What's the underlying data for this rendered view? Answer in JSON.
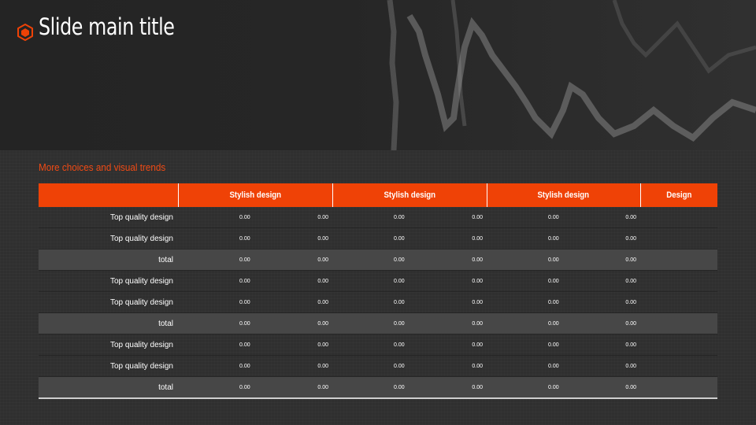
{
  "slide": {
    "title": "Slide main title",
    "subtitle": "More choices and visual trends",
    "accent_color": "#ef4206",
    "icon": "cube-icon"
  },
  "table": {
    "headers": [
      "",
      "Stylish design",
      "Stylish design",
      "Stylish design",
      "Design"
    ],
    "rows": [
      {
        "label": "Top quality design",
        "type": "normal",
        "values": [
          "0.00",
          "0.00",
          "0.00",
          "0.00",
          "0.00",
          "0.00"
        ]
      },
      {
        "label": "Top quality design",
        "type": "normal",
        "values": [
          "0.00",
          "0.00",
          "0.00",
          "0.00",
          "0.00",
          "0.00"
        ]
      },
      {
        "label": "total",
        "type": "total",
        "values": [
          "0.00",
          "0.00",
          "0.00",
          "0.00",
          "0.00",
          "0.00"
        ]
      },
      {
        "label": "Top quality design",
        "type": "normal",
        "values": [
          "0.00",
          "0.00",
          "0.00",
          "0.00",
          "0.00",
          "0.00"
        ]
      },
      {
        "label": "Top quality design",
        "type": "normal",
        "values": [
          "0.00",
          "0.00",
          "0.00",
          "0.00",
          "0.00",
          "0.00"
        ]
      },
      {
        "label": "total",
        "type": "total",
        "values": [
          "0.00",
          "0.00",
          "0.00",
          "0.00",
          "0.00",
          "0.00"
        ]
      },
      {
        "label": "Top quality design",
        "type": "normal",
        "values": [
          "0.00",
          "0.00",
          "0.00",
          "0.00",
          "0.00",
          "0.00"
        ]
      },
      {
        "label": "Top quality design",
        "type": "normal",
        "values": [
          "0.00",
          "0.00",
          "0.00",
          "0.00",
          "0.00",
          "0.00"
        ]
      },
      {
        "label": "total",
        "type": "total",
        "values": [
          "0.00",
          "0.00",
          "0.00",
          "0.00",
          "0.00",
          "0.00"
        ]
      }
    ]
  }
}
